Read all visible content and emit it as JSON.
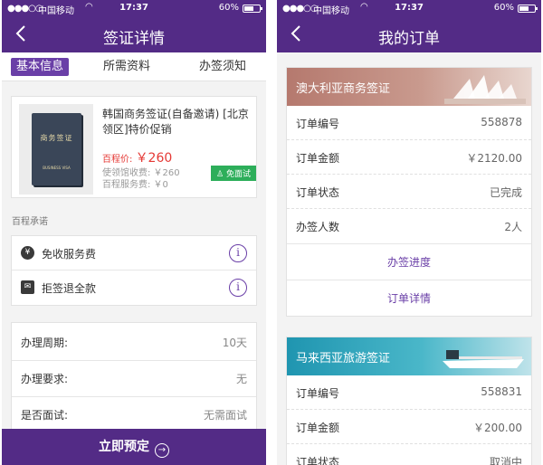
{
  "status": {
    "carrier": "中国移动",
    "time": "17:37",
    "battery": "60%"
  },
  "left": {
    "title": "签证详情",
    "tabs": [
      "基本信息",
      "所需资料",
      "办签须知"
    ],
    "product": {
      "cover_text": "商务签证",
      "cover_subtext": "BUSINESS VISA",
      "title": "韩国商务签证(自备邀请) [北京领区]特价促销",
      "price_label": "百程价:",
      "price": "￥260",
      "consulate_fee": "使领馆收费: ￥260",
      "service_fee": "百程服务费: ￥0",
      "badge": "免面试"
    },
    "promise_label": "百程承诺",
    "promises": [
      {
        "icon": "¥",
        "label": "免收服务费"
      },
      {
        "icon": "✉",
        "label": "拒签退全款"
      }
    ],
    "details": [
      {
        "key": "办理周期:",
        "value": "10天"
      },
      {
        "key": "办理要求:",
        "value": "无"
      },
      {
        "key": "是否面试:",
        "value": "无需面试"
      }
    ],
    "book_button": "立即预定"
  },
  "right": {
    "title": "我的订单",
    "orders": [
      {
        "banner": "澳大利亚商务签证",
        "banner_color": "#b9857c",
        "rows": [
          {
            "key": "订单编号",
            "value": "558878"
          },
          {
            "key": "订单金额",
            "value": "￥2120.00"
          },
          {
            "key": "订单状态",
            "value": "已完成"
          },
          {
            "key": "办签人数",
            "value": "2人"
          }
        ],
        "progress_link": "办签进度",
        "detail_link": "订单详情"
      },
      {
        "banner": "马来西亚旅游签证",
        "banner_color": "#2aa0b8",
        "rows": [
          {
            "key": "订单编号",
            "value": "558831"
          },
          {
            "key": "订单金额",
            "value": "￥200.00"
          },
          {
            "key": "订单状态",
            "value": "取消中"
          }
        ]
      }
    ]
  }
}
